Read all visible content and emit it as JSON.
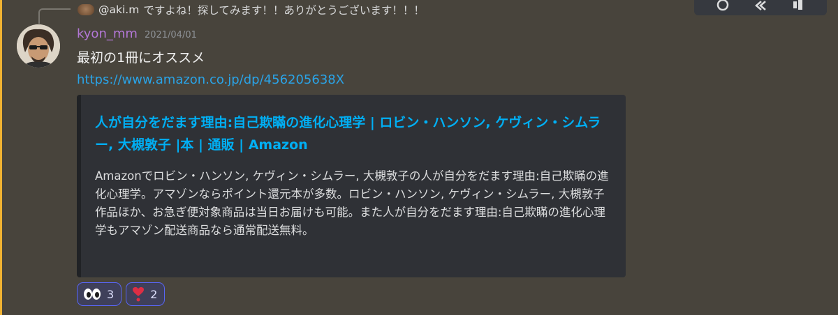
{
  "reply": {
    "author": "@aki.m",
    "text": "ですよね！探してみます！！ありがとうございます！！！"
  },
  "toolbar": {
    "icons": [
      "refresh-icon",
      "reply-icon",
      "more-icon"
    ]
  },
  "message": {
    "username": "kyon_mm",
    "timestamp": "2021/04/01",
    "content": "最初の1冊にオススメ",
    "link": "https://www.amazon.co.jp/dp/456205638X",
    "username_color": "#b377d6"
  },
  "embed": {
    "title": "人が自分をだます理由:自己欺瞞の進化心理学 | ロビン・ハンソン, ケヴィン・シムラー, 大槻敦子 |本 | 通販 | Amazon",
    "description": "Amazonでロビン・ハンソン, ケヴィン・シムラー, 大槻敦子の人が自分をだます理由:自己欺瞞の進化心理学。アマゾンならポイント還元本が多数。ロビン・ハンソン, ケヴィン・シムラー, 大槻敦子作品ほか、お急ぎ便対象商品は当日お届けも可能。また人が自分をだます理由:自己欺瞞の進化心理学もアマゾン配送商品なら通常配送無料。",
    "title_color": "#00aff4"
  },
  "reactions": [
    {
      "emoji": "eyes-icon",
      "count": "3"
    },
    {
      "emoji": "heart-exclamation-icon",
      "count": "2"
    }
  ],
  "colors": {
    "accent_border": "#f0b232",
    "reaction_border": "#5865f2",
    "link": "#2aa4e8"
  }
}
